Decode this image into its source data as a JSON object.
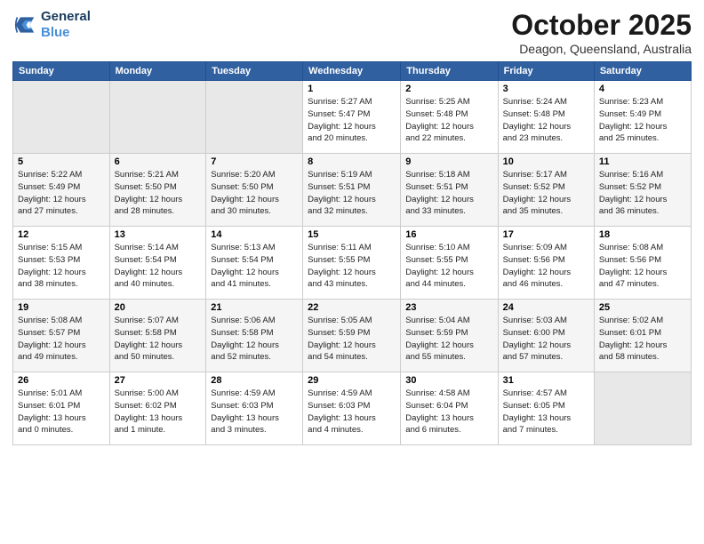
{
  "header": {
    "logo_line1": "General",
    "logo_line2": "Blue",
    "month": "October 2025",
    "location": "Deagon, Queensland, Australia"
  },
  "weekdays": [
    "Sunday",
    "Monday",
    "Tuesday",
    "Wednesday",
    "Thursday",
    "Friday",
    "Saturday"
  ],
  "weeks": [
    [
      {
        "day": "",
        "info": ""
      },
      {
        "day": "",
        "info": ""
      },
      {
        "day": "",
        "info": ""
      },
      {
        "day": "1",
        "info": "Sunrise: 5:27 AM\nSunset: 5:47 PM\nDaylight: 12 hours\nand 20 minutes."
      },
      {
        "day": "2",
        "info": "Sunrise: 5:25 AM\nSunset: 5:48 PM\nDaylight: 12 hours\nand 22 minutes."
      },
      {
        "day": "3",
        "info": "Sunrise: 5:24 AM\nSunset: 5:48 PM\nDaylight: 12 hours\nand 23 minutes."
      },
      {
        "day": "4",
        "info": "Sunrise: 5:23 AM\nSunset: 5:49 PM\nDaylight: 12 hours\nand 25 minutes."
      }
    ],
    [
      {
        "day": "5",
        "info": "Sunrise: 5:22 AM\nSunset: 5:49 PM\nDaylight: 12 hours\nand 27 minutes."
      },
      {
        "day": "6",
        "info": "Sunrise: 5:21 AM\nSunset: 5:50 PM\nDaylight: 12 hours\nand 28 minutes."
      },
      {
        "day": "7",
        "info": "Sunrise: 5:20 AM\nSunset: 5:50 PM\nDaylight: 12 hours\nand 30 minutes."
      },
      {
        "day": "8",
        "info": "Sunrise: 5:19 AM\nSunset: 5:51 PM\nDaylight: 12 hours\nand 32 minutes."
      },
      {
        "day": "9",
        "info": "Sunrise: 5:18 AM\nSunset: 5:51 PM\nDaylight: 12 hours\nand 33 minutes."
      },
      {
        "day": "10",
        "info": "Sunrise: 5:17 AM\nSunset: 5:52 PM\nDaylight: 12 hours\nand 35 minutes."
      },
      {
        "day": "11",
        "info": "Sunrise: 5:16 AM\nSunset: 5:52 PM\nDaylight: 12 hours\nand 36 minutes."
      }
    ],
    [
      {
        "day": "12",
        "info": "Sunrise: 5:15 AM\nSunset: 5:53 PM\nDaylight: 12 hours\nand 38 minutes."
      },
      {
        "day": "13",
        "info": "Sunrise: 5:14 AM\nSunset: 5:54 PM\nDaylight: 12 hours\nand 40 minutes."
      },
      {
        "day": "14",
        "info": "Sunrise: 5:13 AM\nSunset: 5:54 PM\nDaylight: 12 hours\nand 41 minutes."
      },
      {
        "day": "15",
        "info": "Sunrise: 5:11 AM\nSunset: 5:55 PM\nDaylight: 12 hours\nand 43 minutes."
      },
      {
        "day": "16",
        "info": "Sunrise: 5:10 AM\nSunset: 5:55 PM\nDaylight: 12 hours\nand 44 minutes."
      },
      {
        "day": "17",
        "info": "Sunrise: 5:09 AM\nSunset: 5:56 PM\nDaylight: 12 hours\nand 46 minutes."
      },
      {
        "day": "18",
        "info": "Sunrise: 5:08 AM\nSunset: 5:56 PM\nDaylight: 12 hours\nand 47 minutes."
      }
    ],
    [
      {
        "day": "19",
        "info": "Sunrise: 5:08 AM\nSunset: 5:57 PM\nDaylight: 12 hours\nand 49 minutes."
      },
      {
        "day": "20",
        "info": "Sunrise: 5:07 AM\nSunset: 5:58 PM\nDaylight: 12 hours\nand 50 minutes."
      },
      {
        "day": "21",
        "info": "Sunrise: 5:06 AM\nSunset: 5:58 PM\nDaylight: 12 hours\nand 52 minutes."
      },
      {
        "day": "22",
        "info": "Sunrise: 5:05 AM\nSunset: 5:59 PM\nDaylight: 12 hours\nand 54 minutes."
      },
      {
        "day": "23",
        "info": "Sunrise: 5:04 AM\nSunset: 5:59 PM\nDaylight: 12 hours\nand 55 minutes."
      },
      {
        "day": "24",
        "info": "Sunrise: 5:03 AM\nSunset: 6:00 PM\nDaylight: 12 hours\nand 57 minutes."
      },
      {
        "day": "25",
        "info": "Sunrise: 5:02 AM\nSunset: 6:01 PM\nDaylight: 12 hours\nand 58 minutes."
      }
    ],
    [
      {
        "day": "26",
        "info": "Sunrise: 5:01 AM\nSunset: 6:01 PM\nDaylight: 13 hours\nand 0 minutes."
      },
      {
        "day": "27",
        "info": "Sunrise: 5:00 AM\nSunset: 6:02 PM\nDaylight: 13 hours\nand 1 minute."
      },
      {
        "day": "28",
        "info": "Sunrise: 4:59 AM\nSunset: 6:03 PM\nDaylight: 13 hours\nand 3 minutes."
      },
      {
        "day": "29",
        "info": "Sunrise: 4:59 AM\nSunset: 6:03 PM\nDaylight: 13 hours\nand 4 minutes."
      },
      {
        "day": "30",
        "info": "Sunrise: 4:58 AM\nSunset: 6:04 PM\nDaylight: 13 hours\nand 6 minutes."
      },
      {
        "day": "31",
        "info": "Sunrise: 4:57 AM\nSunset: 6:05 PM\nDaylight: 13 hours\nand 7 minutes."
      },
      {
        "day": "",
        "info": ""
      }
    ]
  ]
}
